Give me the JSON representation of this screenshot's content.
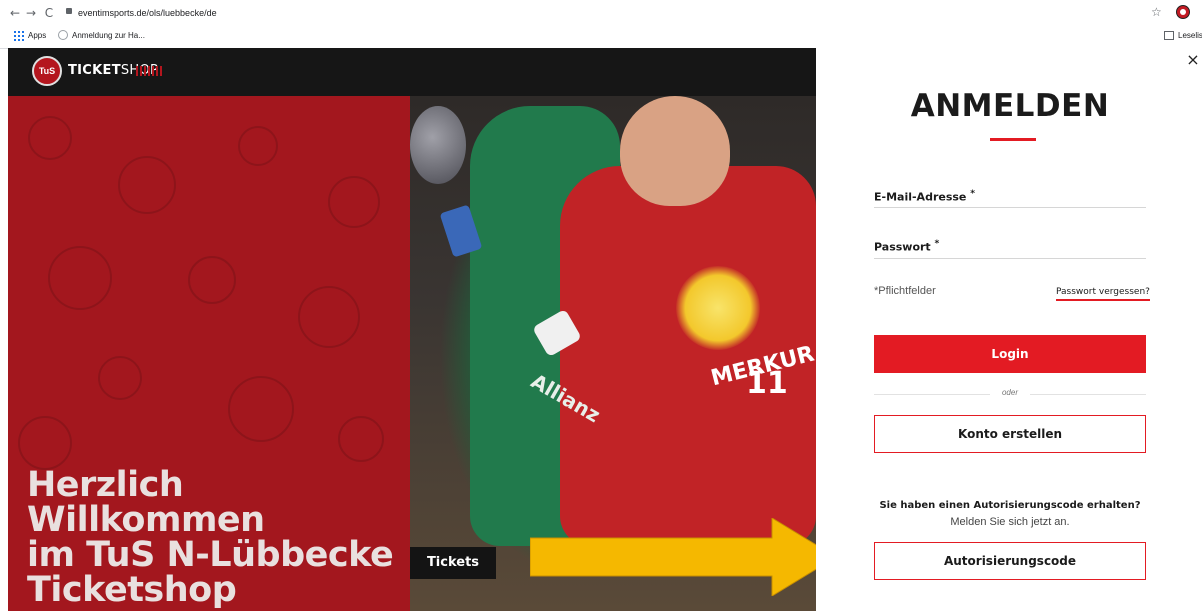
{
  "browser": {
    "url": "eventimsports.de/ols/luebbecke/de",
    "nav": {
      "back": "←",
      "forward": "→",
      "reload": "C"
    },
    "star_icon": "☆",
    "bookmarks": [
      {
        "label": "Apps"
      },
      {
        "label": "Anmeldung zur Ha..."
      }
    ],
    "reading_list": "Leselis"
  },
  "header": {
    "logo_badge": "TuS",
    "logo_text_bold": "TICKET",
    "logo_text_thin": "SHOP"
  },
  "hero": {
    "title_lines": [
      "Herzlich Willkommen",
      "im TuS N-Lübbecke",
      "Ticketshop"
    ],
    "jersey_sponsor": "MERKUR",
    "jersey_number": "11",
    "shirt_sponsor": "Allianz"
  },
  "tabs": {
    "tickets": "Tickets"
  },
  "modal": {
    "close": "×",
    "title": "ANMELDEN",
    "email_label": "E-Mail-Adresse",
    "password_label": "Passwort",
    "required_marker": "*",
    "required_note": "*Pflichtfelder",
    "forgot_password": "Passwort vergessen?",
    "login_button": "Login",
    "or": "oder",
    "create_account": "Konto erstellen",
    "auth_heading": "Sie haben einen Autorisierungscode erhalten?",
    "auth_sub": "Melden Sie sich jetzt an.",
    "auth_button": "Autorisierungscode"
  },
  "colors": {
    "accent": "#e31b23",
    "hero_red": "#a3171e",
    "header_black": "#161616",
    "annotation_arrow": "#f5b800"
  },
  "icons": [
    "back-icon",
    "forward-icon",
    "reload-icon",
    "lock-icon",
    "star-icon",
    "profile-icon",
    "apps-icon",
    "globe-icon",
    "reading-list-icon",
    "close-icon",
    "annotation-arrow"
  ]
}
